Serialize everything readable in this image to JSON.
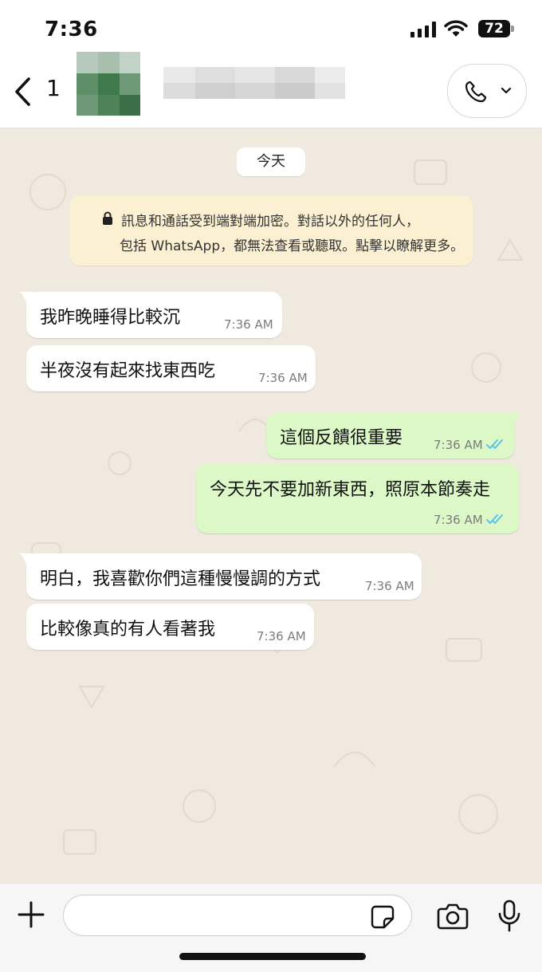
{
  "status_bar": {
    "time": "7:36",
    "battery": "72"
  },
  "header": {
    "back_count": "1"
  },
  "chat": {
    "date_label": "今天",
    "encryption_notice": {
      "line1": "訊息和通話受到端對端加密。對話以外的任何人，",
      "line2": "包括 WhatsApp，都無法查看或聽取。點擊以瞭解更多。"
    },
    "messages": [
      {
        "direction": "in",
        "text": "我昨晚睡得比較沉",
        "time": "7:36 AM"
      },
      {
        "direction": "in",
        "text": "半夜沒有起來找東西吃",
        "time": "7:36 AM"
      },
      {
        "direction": "out",
        "text": "這個反饋很重要",
        "time": "7:36 AM",
        "status": "read"
      },
      {
        "direction": "out",
        "text": "今天先不要加新東西，照原本節奏走",
        "time": "7:36 AM",
        "status": "read"
      },
      {
        "direction": "in",
        "text": "明白，我喜歡你們這種慢慢調的方式",
        "time": "7:36 AM"
      },
      {
        "direction": "in",
        "text": "比較像真的有人看著我",
        "time": "7:36 AM"
      }
    ]
  },
  "composer": {
    "input_value": ""
  },
  "colors": {
    "chat_background": "#efe9df",
    "incoming_bubble": "#ffffff",
    "outgoing_bubble": "#dbf8c6",
    "notice_background": "#fbf1d2",
    "read_tick": "#53bdeb"
  },
  "icons": {
    "back": "chevron-left-icon",
    "call": "phone-icon",
    "call_menu": "chevron-down-icon",
    "notice": "lock-icon",
    "attach": "plus-icon",
    "sticker": "sticker-icon",
    "camera": "camera-icon",
    "mic": "microphone-icon",
    "read_receipt": "double-check-icon"
  }
}
